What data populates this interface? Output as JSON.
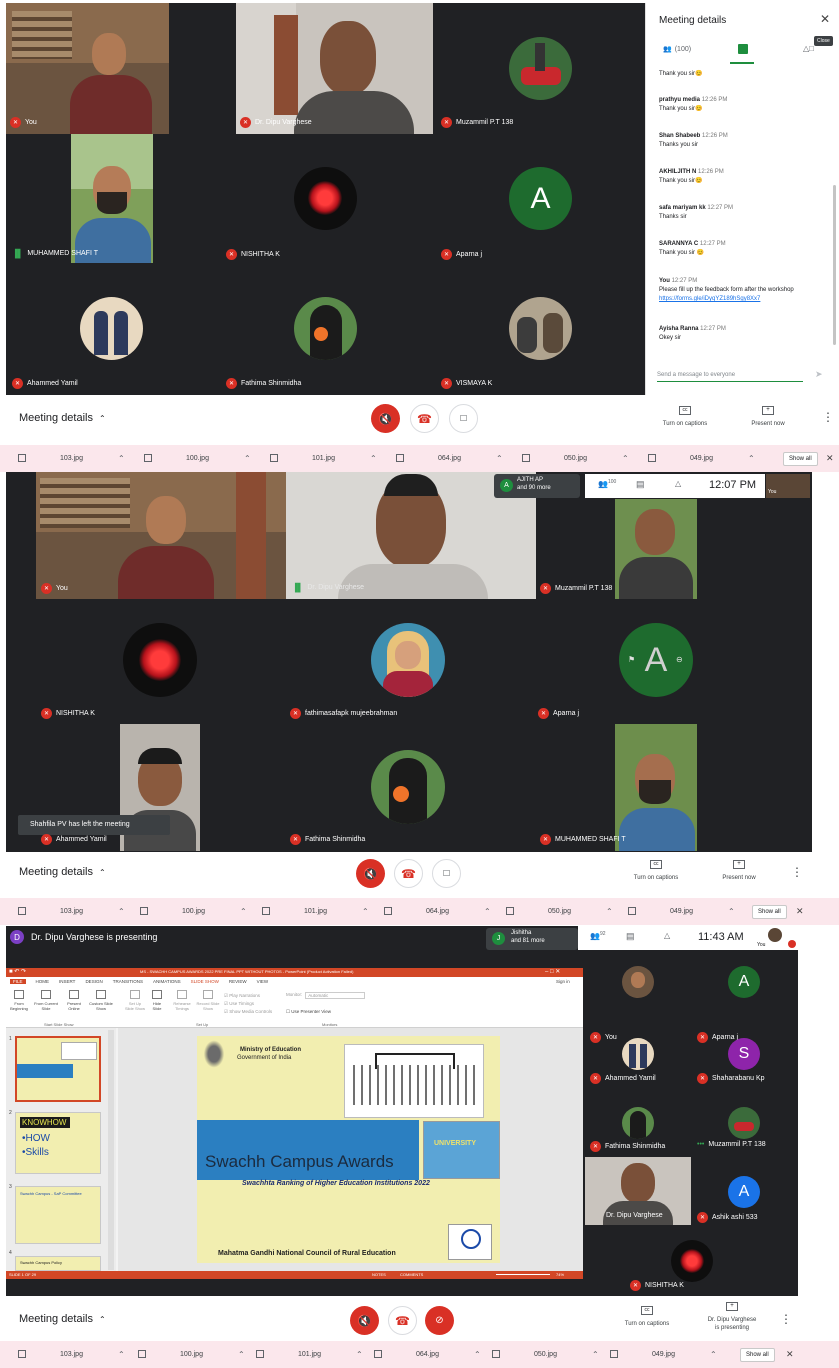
{
  "panel1": {
    "tiles": [
      {
        "name": "You"
      },
      {
        "name": "Dr. Dipu Varghese"
      },
      {
        "name": "Muzammil P.T 138"
      },
      {
        "name": "MUHAMMED SHAFI T"
      },
      {
        "name": "NISHITHA K"
      },
      {
        "name": "Aparna j",
        "initial": "A"
      },
      {
        "name": "Ahammed Yamil"
      },
      {
        "name": "Fathima Shinmidha"
      },
      {
        "name": "VISMAYA K"
      }
    ],
    "sidebar": {
      "title": "Meeting details",
      "close_tooltip": "Close",
      "people_count": "(100)",
      "messages": [
        {
          "sender": "",
          "time": "",
          "text": "Thank you sir😊"
        },
        {
          "sender": "prathyu media",
          "time": "12:26 PM",
          "text": "Thank you sir😊"
        },
        {
          "sender": "Shan Shabeeb",
          "time": "12:26 PM",
          "text": "Thanks you sir"
        },
        {
          "sender": "AKHILJITH N",
          "time": "12:26 PM",
          "text": "Thank you sir😊"
        },
        {
          "sender": "safa mariyam kk",
          "time": "12:27 PM",
          "text": "Thanks sir"
        },
        {
          "sender": "SARANNYA C",
          "time": "12:27 PM",
          "text": "Thank you sir 😊"
        },
        {
          "sender": "You",
          "time": "12:27 PM",
          "text": "Please fill up the feedback form after the workshop",
          "link": "https://forms.gle/iDyqYZ189hSgy8Xx7"
        },
        {
          "sender": "Ayisha Ranna",
          "time": "12:27 PM",
          "text": "Okey sir"
        }
      ],
      "input_placeholder": "Send a message to everyone"
    },
    "controls": {
      "meeting_details": "Meeting details",
      "captions": "Turn on captions",
      "present": "Present now"
    }
  },
  "downloads": {
    "files": [
      "103.jpg",
      "100.jpg",
      "101.jpg",
      "064.jpg",
      "050.jpg",
      "049.jpg"
    ],
    "show_all": "Show all"
  },
  "panel2": {
    "header": {
      "initial": "A",
      "name": "AJITH AP",
      "more": "and 90 more",
      "count": "100",
      "time": "12:07 PM",
      "you": "You"
    },
    "tiles": [
      {
        "name": "You"
      },
      {
        "name": "Dr. Dipu Varghese"
      },
      {
        "name": "Muzammil P.T 138"
      },
      {
        "name": "NISHITHA K"
      },
      {
        "name": "fathimasafapk mujeebrahman"
      },
      {
        "name": "Aparna j",
        "initial": "A"
      },
      {
        "name": "Ahammed Yamil"
      },
      {
        "name": "Fathima Shinmidha"
      },
      {
        "name": "MUHAMMED SHAFI T"
      }
    ],
    "toast": "Shahfila PV has left the meeting",
    "controls": {
      "meeting_details": "Meeting details",
      "captions": "Turn on captions",
      "present": "Present now"
    }
  },
  "panel3": {
    "presenting_initial": "D",
    "presenting_text": "Dr. Dipu Varghese is presenting",
    "header": {
      "initial": "J",
      "name": "Jishitha",
      "more": "and 81 more",
      "count": "92",
      "time": "11:43 AM",
      "you": "You"
    },
    "ppt": {
      "title": "MS - SWACHH CAMPUS AWARDS 2022 PRE FINAL PPT WITHOUT PHOTOS - PowerPoint (Product Activation Failed)",
      "tabs": [
        "FILE",
        "HOME",
        "INSERT",
        "DESIGN",
        "TRANSITIONS",
        "ANIMATIONS",
        "SLIDE SHOW",
        "REVIEW",
        "VIEW"
      ],
      "sign_in": "Sign in",
      "ribbon": [
        "From Beginning",
        "From Current Slide",
        "Present Online",
        "Custom Slide Show",
        "Set Up Slide Show",
        "Hide Slide",
        "Rehearse Timings",
        "Record Slide Show"
      ],
      "checks": [
        "Play Narrations",
        "Use Timings",
        "Show Media Controls"
      ],
      "monitor_label": "Monitor:",
      "monitor_value": "Automatic",
      "presenter_view": "Use Presenter View",
      "groups": [
        "Start Slide Show",
        "Set Up",
        "Monitors"
      ],
      "thumb_numbers": [
        "1",
        "2",
        "3",
        "4"
      ],
      "thumb2": {
        "title": "KNOWHOW",
        "l1": "•HOW",
        "l2": "•Skills"
      },
      "thumb3": "Swachh Campus - SaP Committee",
      "thumb4": "Swachh Campus Policy",
      "status_left": "SLIDE 1 OF 29",
      "status_notes": "NOTES",
      "status_comments": "COMMENTS",
      "zoom": "74%"
    },
    "slide": {
      "ministry": "Ministry of Education",
      "government": "Government of India",
      "banner": "Swachh Campus Awards",
      "subtitle": "Swachhta Ranking of Higher Education Institutions 2022",
      "footer": "Mahatma Gandhi National Council of Rural Education",
      "univ": "UNIVERSITY"
    },
    "tiles": [
      {
        "name": "You"
      },
      {
        "name": "Aparna j",
        "initial": "A"
      },
      {
        "name": "Ahammed Yamil"
      },
      {
        "name": "Shaharabanu Kp",
        "initial": "S"
      },
      {
        "name": "Fathima Shinmidha"
      },
      {
        "name": "Muzammil P.T 138"
      },
      {
        "name": "Dr. Dipu Varghese"
      },
      {
        "name": "Ashik ashi 533",
        "initial": "A"
      },
      {
        "name": "NISHITHA K"
      }
    ],
    "controls": {
      "meeting_details": "Meeting details",
      "captions": "Turn on captions",
      "present1": "Dr. Dipu Varghese",
      "present2": "is presenting"
    }
  },
  "colors": {
    "red": "#d93025",
    "green": "#1e8e3e",
    "meet_bg": "#202124"
  }
}
